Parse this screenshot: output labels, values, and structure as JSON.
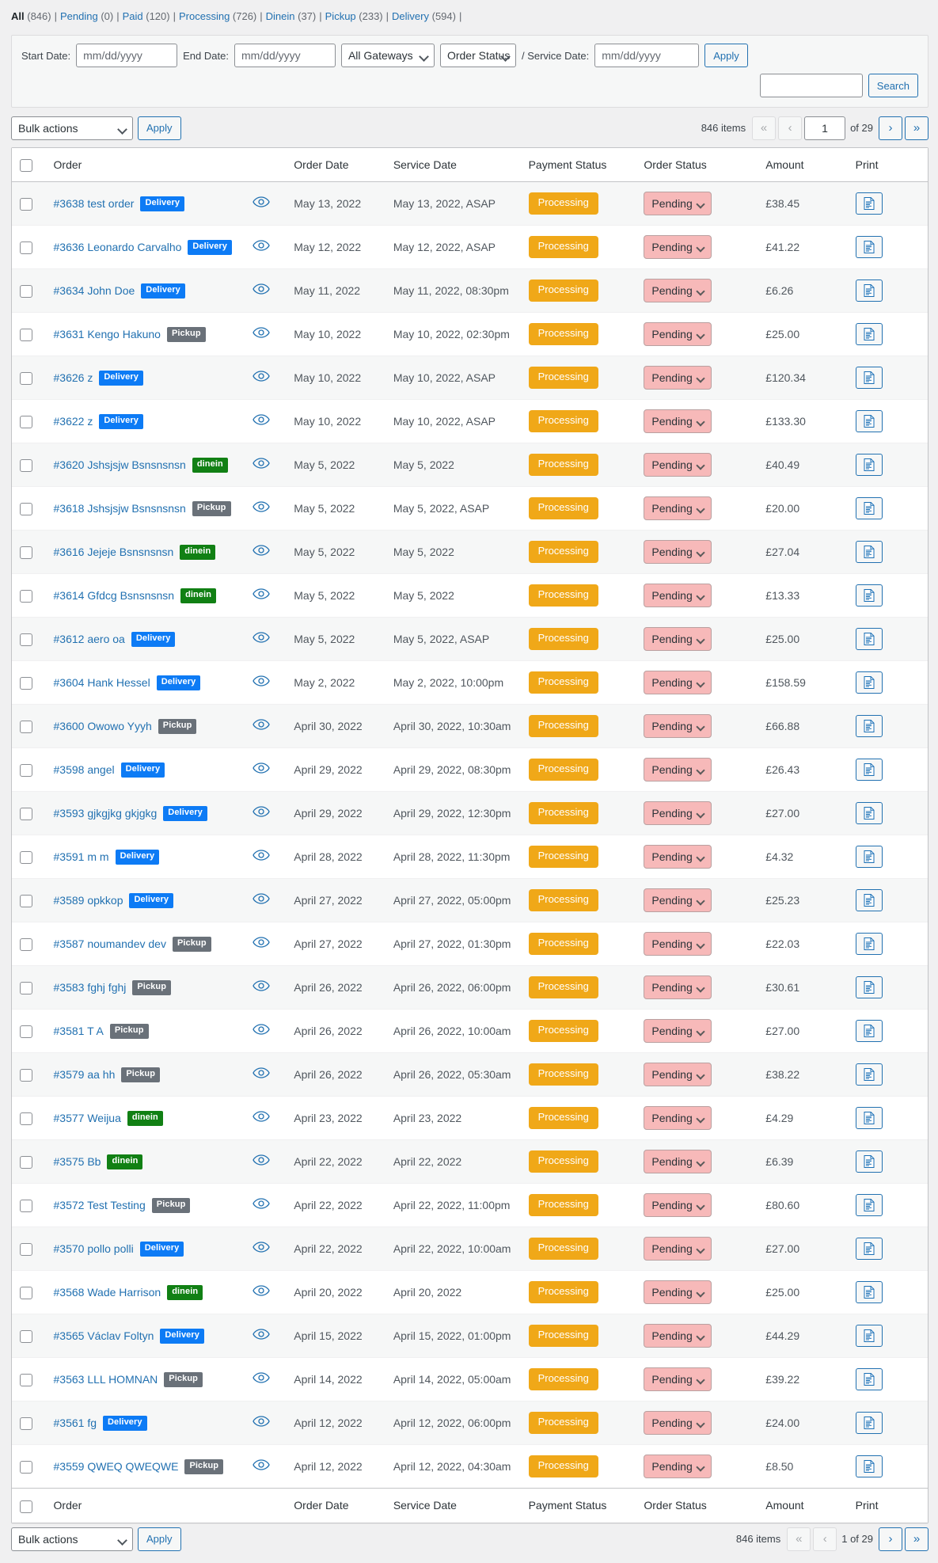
{
  "status_links": [
    {
      "label": "All",
      "count": "(846)",
      "current": true
    },
    {
      "label": "Pending",
      "count": "(0)",
      "current": false
    },
    {
      "label": "Paid",
      "count": "(120)",
      "current": false
    },
    {
      "label": "Processing",
      "count": "(726)",
      "current": false
    },
    {
      "label": "Dinein",
      "count": "(37)",
      "current": false
    },
    {
      "label": "Pickup",
      "count": "(233)",
      "current": false
    },
    {
      "label": "Delivery",
      "count": "(594)",
      "current": false
    }
  ],
  "filters": {
    "start_date_label": "Start Date:",
    "start_date_placeholder": "mm/dd/yyyy",
    "start_date_value": "",
    "end_date_label": "End Date:",
    "end_date_placeholder": "mm/dd/yyyy",
    "end_date_value": "",
    "gateway_selected": "All Gateways",
    "order_status_selected": "Order Status",
    "service_date_label": "/ Service Date:",
    "service_date_placeholder": "mm/dd/yyyy",
    "service_date_value": "",
    "apply_label": "Apply",
    "search_value": "",
    "search_placeholder": "",
    "search_label": "Search"
  },
  "tablenav": {
    "bulk_selected": "Bulk actions",
    "apply_label": "Apply",
    "items_count": "846 items",
    "first_label": "«",
    "prev_label": "‹",
    "current_page": "1",
    "of_total": "of 29",
    "next_label": "›",
    "last_label": "»"
  },
  "tablenav_bottom": {
    "bulk_selected": "Bulk actions",
    "apply_label": "Apply",
    "items_count": "846 items",
    "first_label": "«",
    "prev_label": "‹",
    "current_page": "1 of 29",
    "next_label": "›",
    "last_label": "»"
  },
  "columns": {
    "order": "Order",
    "order_date": "Order Date",
    "service_date": "Service Date",
    "payment_status": "Payment Status",
    "order_status": "Order Status",
    "amount": "Amount",
    "print": "Print"
  },
  "rows": [
    {
      "order": "#3638 test order",
      "badge": "Delivery",
      "badge_type": "delivery",
      "order_date": "May 13, 2022",
      "service_date": "May 13, 2022, ASAP",
      "payment_status": "Processing",
      "order_status": "Pending",
      "amount": "£38.45"
    },
    {
      "order": "#3636 Leonardo Carvalho",
      "badge": "Delivery",
      "badge_type": "delivery",
      "order_date": "May 12, 2022",
      "service_date": "May 12, 2022, ASAP",
      "payment_status": "Processing",
      "order_status": "Pending",
      "amount": "£41.22"
    },
    {
      "order": "#3634 John Doe",
      "badge": "Delivery",
      "badge_type": "delivery",
      "order_date": "May 11, 2022",
      "service_date": "May 11, 2022, 08:30pm",
      "payment_status": "Processing",
      "order_status": "Pending",
      "amount": "£6.26"
    },
    {
      "order": "#3631 Kengo Hakuno",
      "badge": "Pickup",
      "badge_type": "pickup",
      "order_date": "May 10, 2022",
      "service_date": "May 10, 2022, 02:30pm",
      "payment_status": "Processing",
      "order_status": "Pending",
      "amount": "£25.00"
    },
    {
      "order": "#3626 z",
      "badge": "Delivery",
      "badge_type": "delivery",
      "order_date": "May 10, 2022",
      "service_date": "May 10, 2022, ASAP",
      "payment_status": "Processing",
      "order_status": "Pending",
      "amount": "£120.34"
    },
    {
      "order": "#3622 z",
      "badge": "Delivery",
      "badge_type": "delivery",
      "order_date": "May 10, 2022",
      "service_date": "May 10, 2022, ASAP",
      "payment_status": "Processing",
      "order_status": "Pending",
      "amount": "£133.30"
    },
    {
      "order": "#3620 Jshsjsjw Bsnsnsnsn",
      "badge": "dinein",
      "badge_type": "dinein",
      "order_date": "May 5, 2022",
      "service_date": "May 5, 2022",
      "payment_status": "Processing",
      "order_status": "Pending",
      "amount": "£40.49"
    },
    {
      "order": "#3618 Jshsjsjw Bsnsnsnsn",
      "badge": "Pickup",
      "badge_type": "pickup",
      "order_date": "May 5, 2022",
      "service_date": "May 5, 2022, ASAP",
      "payment_status": "Processing",
      "order_status": "Pending",
      "amount": "£20.00"
    },
    {
      "order": "#3616 Jejeje Bsnsnsnsn",
      "badge": "dinein",
      "badge_type": "dinein",
      "order_date": "May 5, 2022",
      "service_date": "May 5, 2022",
      "payment_status": "Processing",
      "order_status": "Pending",
      "amount": "£27.04"
    },
    {
      "order": "#3614 Gfdcg Bsnsnsnsn",
      "badge": "dinein",
      "badge_type": "dinein",
      "order_date": "May 5, 2022",
      "service_date": "May 5, 2022",
      "payment_status": "Processing",
      "order_status": "Pending",
      "amount": "£13.33"
    },
    {
      "order": "#3612 aero oa",
      "badge": "Delivery",
      "badge_type": "delivery",
      "order_date": "May 5, 2022",
      "service_date": "May 5, 2022, ASAP",
      "payment_status": "Processing",
      "order_status": "Pending",
      "amount": "£25.00"
    },
    {
      "order": "#3604 Hank Hessel",
      "badge": "Delivery",
      "badge_type": "delivery",
      "order_date": "May 2, 2022",
      "service_date": "May 2, 2022, 10:00pm",
      "payment_status": "Processing",
      "order_status": "Pending",
      "amount": "£158.59"
    },
    {
      "order": "#3600 Owowo Yyyh",
      "badge": "Pickup",
      "badge_type": "pickup",
      "order_date": "April 30, 2022",
      "service_date": "April 30, 2022, 10:30am",
      "payment_status": "Processing",
      "order_status": "Pending",
      "amount": "£66.88"
    },
    {
      "order": "#3598 angel",
      "badge": "Delivery",
      "badge_type": "delivery",
      "order_date": "April 29, 2022",
      "service_date": "April 29, 2022, 08:30pm",
      "payment_status": "Processing",
      "order_status": "Pending",
      "amount": "£26.43"
    },
    {
      "order": "#3593 gjkgjkg gkjgkg",
      "badge": "Delivery",
      "badge_type": "delivery",
      "order_date": "April 29, 2022",
      "service_date": "April 29, 2022, 12:30pm",
      "payment_status": "Processing",
      "order_status": "Pending",
      "amount": "£27.00"
    },
    {
      "order": "#3591 m m",
      "badge": "Delivery",
      "badge_type": "delivery",
      "order_date": "April 28, 2022",
      "service_date": "April 28, 2022, 11:30pm",
      "payment_status": "Processing",
      "order_status": "Pending",
      "amount": "£4.32"
    },
    {
      "order": "#3589 opkkop",
      "badge": "Delivery",
      "badge_type": "delivery",
      "order_date": "April 27, 2022",
      "service_date": "April 27, 2022, 05:00pm",
      "payment_status": "Processing",
      "order_status": "Pending",
      "amount": "£25.23"
    },
    {
      "order": "#3587 noumandev dev",
      "badge": "Pickup",
      "badge_type": "pickup",
      "order_date": "April 27, 2022",
      "service_date": "April 27, 2022, 01:30pm",
      "payment_status": "Processing",
      "order_status": "Pending",
      "amount": "£22.03"
    },
    {
      "order": "#3583 fghj fghj",
      "badge": "Pickup",
      "badge_type": "pickup",
      "order_date": "April 26, 2022",
      "service_date": "April 26, 2022, 06:00pm",
      "payment_status": "Processing",
      "order_status": "Pending",
      "amount": "£30.61"
    },
    {
      "order": "#3581 T A",
      "badge": "Pickup",
      "badge_type": "pickup",
      "order_date": "April 26, 2022",
      "service_date": "April 26, 2022, 10:00am",
      "payment_status": "Processing",
      "order_status": "Pending",
      "amount": "£27.00"
    },
    {
      "order": "#3579 aa hh",
      "badge": "Pickup",
      "badge_type": "pickup",
      "order_date": "April 26, 2022",
      "service_date": "April 26, 2022, 05:30am",
      "payment_status": "Processing",
      "order_status": "Pending",
      "amount": "£38.22"
    },
    {
      "order": "#3577 Weijua",
      "badge": "dinein",
      "badge_type": "dinein",
      "order_date": "April 23, 2022",
      "service_date": "April 23, 2022",
      "payment_status": "Processing",
      "order_status": "Pending",
      "amount": "£4.29"
    },
    {
      "order": "#3575 Bb",
      "badge": "dinein",
      "badge_type": "dinein",
      "order_date": "April 22, 2022",
      "service_date": "April 22, 2022",
      "payment_status": "Processing",
      "order_status": "Pending",
      "amount": "£6.39"
    },
    {
      "order": "#3572 Test Testing",
      "badge": "Pickup",
      "badge_type": "pickup",
      "order_date": "April 22, 2022",
      "service_date": "April 22, 2022, 11:00pm",
      "payment_status": "Processing",
      "order_status": "Pending",
      "amount": "£80.60"
    },
    {
      "order": "#3570 pollo polli",
      "badge": "Delivery",
      "badge_type": "delivery",
      "order_date": "April 22, 2022",
      "service_date": "April 22, 2022, 10:00am",
      "payment_status": "Processing",
      "order_status": "Pending",
      "amount": "£27.00"
    },
    {
      "order": "#3568 Wade Harrison",
      "badge": "dinein",
      "badge_type": "dinein",
      "order_date": "April 20, 2022",
      "service_date": "April 20, 2022",
      "payment_status": "Processing",
      "order_status": "Pending",
      "amount": "£25.00"
    },
    {
      "order": "#3565 Václav Foltyn",
      "badge": "Delivery",
      "badge_type": "delivery",
      "order_date": "April 15, 2022",
      "service_date": "April 15, 2022, 01:00pm",
      "payment_status": "Processing",
      "order_status": "Pending",
      "amount": "£44.29"
    },
    {
      "order": "#3563 LLL HOMNAN",
      "badge": "Pickup",
      "badge_type": "pickup",
      "order_date": "April 14, 2022",
      "service_date": "April 14, 2022, 05:00am",
      "payment_status": "Processing",
      "order_status": "Pending",
      "amount": "£39.22"
    },
    {
      "order": "#3561 fg",
      "badge": "Delivery",
      "badge_type": "delivery",
      "order_date": "April 12, 2022",
      "service_date": "April 12, 2022, 06:00pm",
      "payment_status": "Processing",
      "order_status": "Pending",
      "amount": "£24.00"
    },
    {
      "order": "#3559 QWEQ QWEQWE",
      "badge": "Pickup",
      "badge_type": "pickup",
      "order_date": "April 12, 2022",
      "service_date": "April 12, 2022, 04:30am",
      "payment_status": "Processing",
      "order_status": "Pending",
      "amount": "£8.50"
    }
  ],
  "icons": {
    "eye": "eye-icon",
    "print": "print-document-icon"
  },
  "colors": {
    "link": "#2271b1",
    "payment_badge": "#f0a818",
    "status_pending": "#f7b9b9",
    "badge_delivery": "#0d7bf5",
    "badge_pickup": "#6a7179",
    "badge_dinein": "#118014"
  }
}
